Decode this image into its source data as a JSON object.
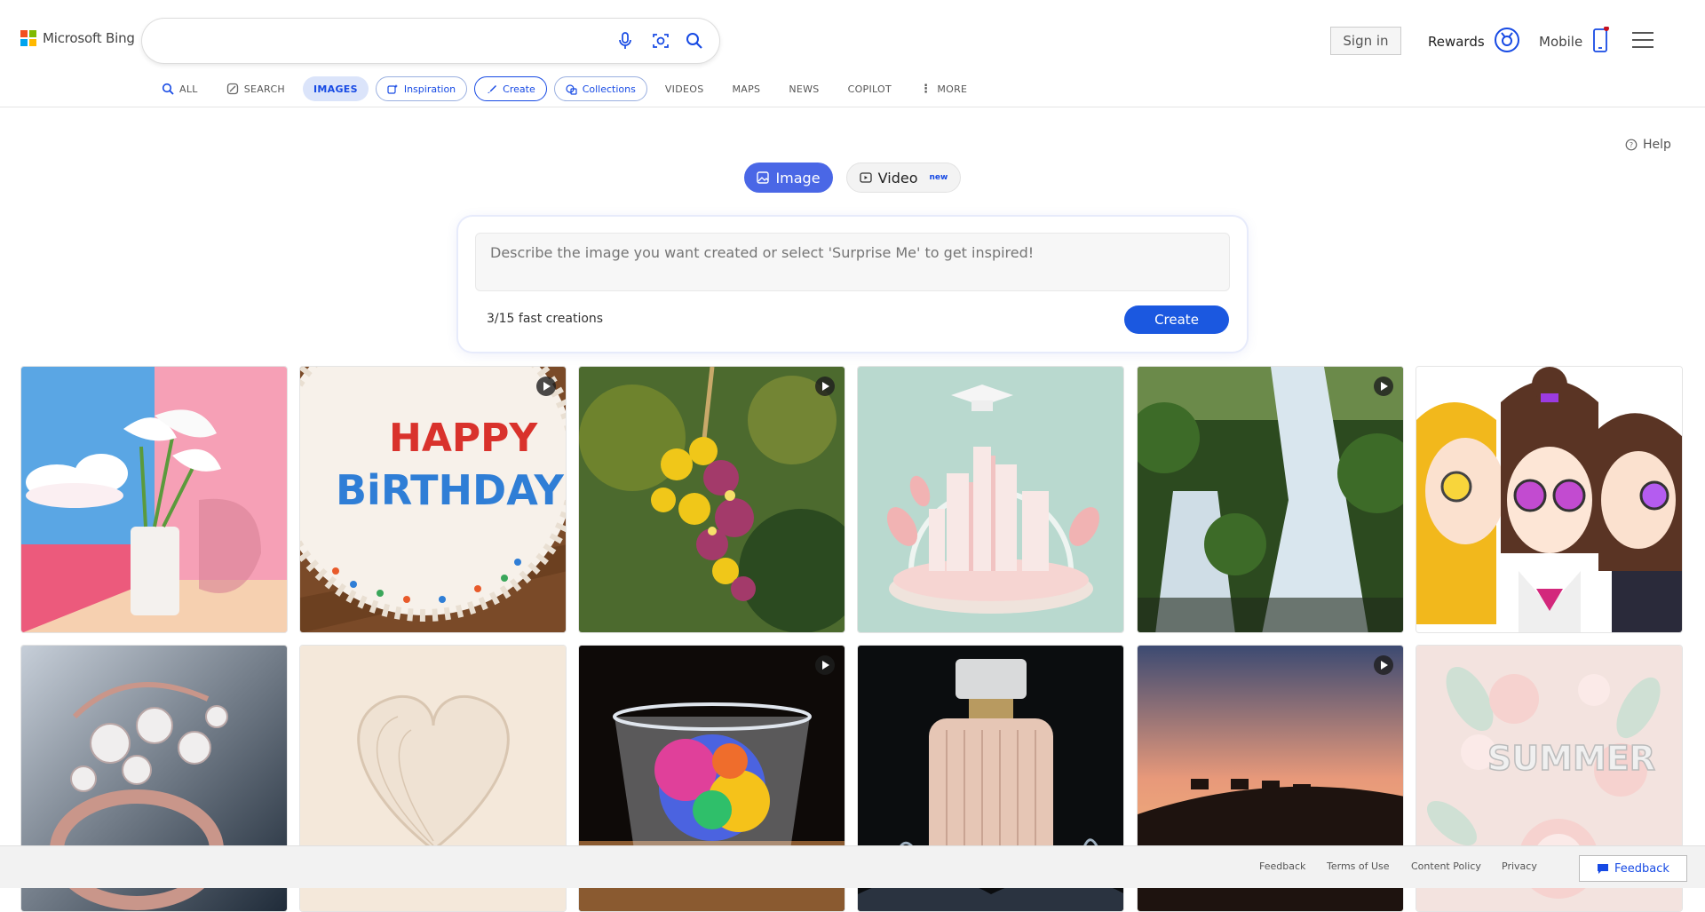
{
  "header": {
    "brand": "Microsoft Bing",
    "search": {
      "value": "",
      "placeholder": ""
    },
    "sign_in": "Sign in",
    "rewards": "Rewards",
    "mobile": "Mobile"
  },
  "nav": {
    "all": "ALL",
    "search": "SEARCH",
    "images": "IMAGES",
    "inspiration": "Inspiration",
    "create": "Create",
    "collections": "Collections",
    "videos": "VIDEOS",
    "maps": "MAPS",
    "news": "NEWS",
    "copilot": "COPILOT",
    "more": "MORE"
  },
  "help": "Help",
  "modes": {
    "image": "Image",
    "video": "Video",
    "video_badge": "new"
  },
  "creator": {
    "placeholder": "Describe the image you want created or select 'Surprise Me' to get inspired!",
    "count": "3/15 fast creations",
    "create": "Create"
  },
  "gallery": [
    {
      "subject": "calla lilies in white vase",
      "video": false
    },
    {
      "subject": "Happy Birthday cake",
      "video": true,
      "cake_text": [
        "HAPPY",
        "BiRTHDAY!"
      ]
    },
    {
      "subject": "colorful flower cluster",
      "video": true
    },
    {
      "subject": "pink paper city with graduation cap",
      "video": false
    },
    {
      "subject": "forest waterfall",
      "video": true
    },
    {
      "subject": "anime friends with sunglasses",
      "video": false
    },
    {
      "subject": "pearl ring",
      "video": false
    },
    {
      "subject": "paper heart",
      "video": false
    },
    {
      "subject": "rainbow glass",
      "video": true
    },
    {
      "subject": "perfume bottle splash",
      "video": false
    },
    {
      "subject": "camels at sunset",
      "video": true
    },
    {
      "subject": "paper flowers summer",
      "video": false,
      "tile_text": "SUMMER"
    }
  ],
  "footer": {
    "links": [
      "Feedback",
      "Terms of Use",
      "Content Policy",
      "Privacy"
    ],
    "feedback_button": "Feedback"
  },
  "colors": {
    "accent": "#174ae4",
    "image_tab": "#4a67e6",
    "create_button": "#1b58e0"
  }
}
